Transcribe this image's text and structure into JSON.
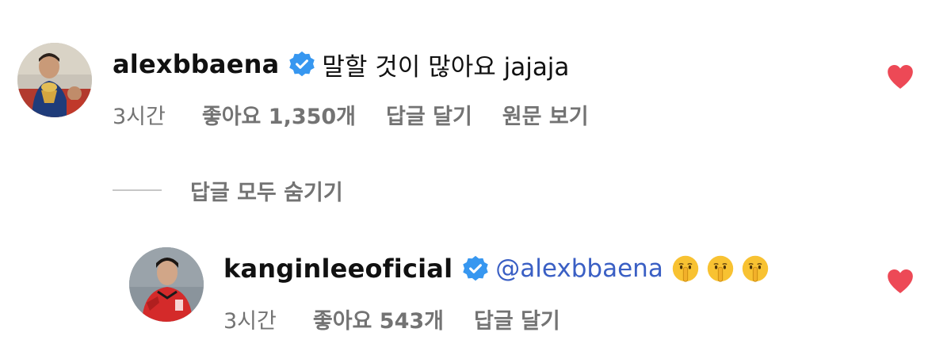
{
  "colors": {
    "heart": "#ed4956",
    "verified": "#3797f0",
    "mention": "#3a5fc4",
    "meta_text": "#737373"
  },
  "comments": [
    {
      "username": "alexbbaena",
      "verified": true,
      "text": "말할 것이 많아요 jajaja",
      "time": "3시간",
      "likes_label": "좋아요 1,350개",
      "reply_label": "답글 달기",
      "translate_label": "원문 보기",
      "liked": true
    },
    {
      "username": "kanginleeoficial",
      "verified": true,
      "mention": "@alexbbaena",
      "emojis": [
        "shushing-face",
        "shushing-face",
        "shushing-face"
      ],
      "time": "3시간",
      "likes_label": "좋아요 543개",
      "reply_label": "답글 달기",
      "liked": true
    }
  ],
  "replies_toggle": {
    "label": "답글 모두 숨기기"
  }
}
